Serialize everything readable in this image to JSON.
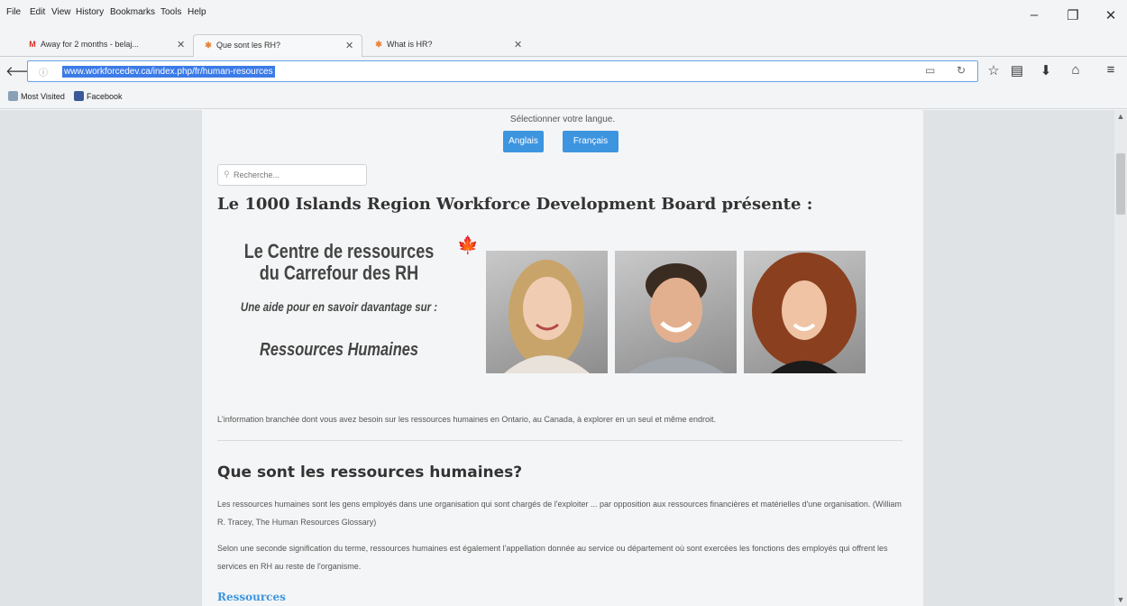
{
  "menu": [
    "File",
    "Edit",
    "View",
    "History",
    "Bookmarks",
    "Tools",
    "Help"
  ],
  "window_controls": {
    "minimize": "–",
    "restore": "❐",
    "close": "✕"
  },
  "tabs": [
    {
      "label": "Away for 2 months - belaj...",
      "icon": "gmail-icon",
      "active": false
    },
    {
      "label": "Que sont les RH?",
      "icon": "joomla-icon",
      "active": true
    },
    {
      "label": "What is HR?",
      "icon": "joomla-icon",
      "active": false
    }
  ],
  "url": "www.workforcedev.ca/index.php/fr/human-resources",
  "bookmarks": [
    {
      "label": "Most Visited",
      "icon": "most-visited-icon"
    },
    {
      "label": "Facebook",
      "icon": "facebook-icon"
    }
  ],
  "page": {
    "lang_prompt": "Sélectionner votre langue.",
    "lang_buttons": [
      "Anglais",
      "Français"
    ],
    "search_placeholder": "Recherche...",
    "main_heading": "Le 1000 Islands Region Workforce Development Board présente :",
    "banner": {
      "line1": "Le Centre de ressources",
      "line2": "du Carrefour des RH",
      "line3": "Une aide pour en savoir davantage sur :",
      "line4": "Ressources Humaines"
    },
    "intro": "L'information branchée dont vous avez besoin sur les ressources humaines en Ontario, au Canada, à explorer en un seul et même endroit.",
    "section_heading": "Que sont les ressources humaines?",
    "para1": "Les ressources humaines sont les gens employés dans une organisation qui sont chargés de l'exploiter ... par opposition aux ressources financières et matérielles d'une organisation. (William R. Tracey, The Human Resources Glossary)",
    "para2": "Selon une seconde signification du terme, ressources humaines est également l'appellation donnée au service ou département où sont exercées les fonctions des employés qui offrent les services en RH au reste de l'organisme.",
    "resources_link": "Ressources"
  },
  "colors": {
    "accent": "#3d95e0",
    "url_highlight": "#3b7be8",
    "maple": "#d81e1e"
  }
}
